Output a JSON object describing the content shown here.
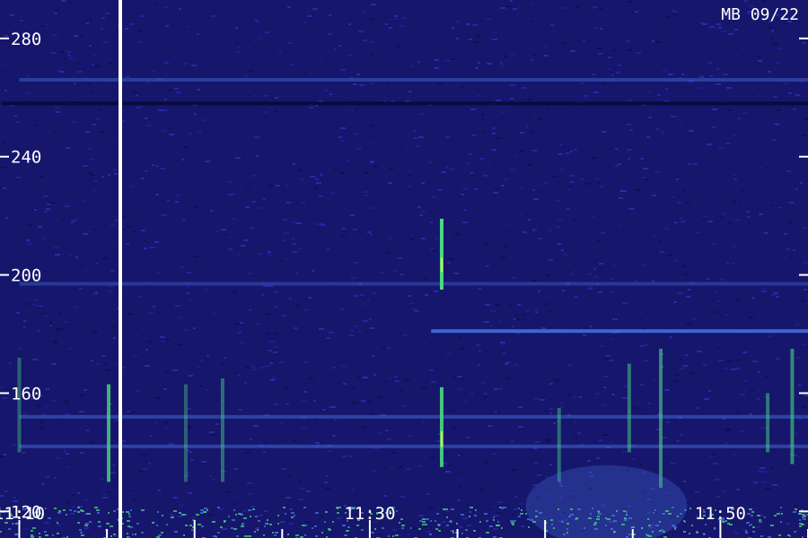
{
  "stamp": "MB 09/22",
  "chart_data": {
    "type": "heatmap",
    "title": "",
    "xlabel": "",
    "ylabel": "",
    "y_ticks": [
      120,
      160,
      200,
      240,
      280
    ],
    "ylim": [
      111,
      293
    ],
    "x_ticks": [
      "11:10",
      "11:30",
      "11:50"
    ],
    "x_tick_values_min": [
      10,
      30,
      50
    ],
    "xlim_min": [
      8.9,
      55
    ],
    "grid": false,
    "colors": {
      "background": "#1a1a7a",
      "noise_low": "#0c0c44",
      "noise_high": "#3a3ad8",
      "band": "#4a7ae8",
      "meteor": "#4ad880",
      "meteor_core": "#e8e83a",
      "axis": "#ffffff"
    },
    "features": [
      {
        "kind": "horizontal-band",
        "y": 181,
        "x_from_min": 33.5,
        "x_to_min": 55,
        "intensity": 0.8
      },
      {
        "kind": "horizontal-band",
        "y": 197,
        "x_from_min": 10,
        "x_to_min": 55,
        "intensity": 0.35
      },
      {
        "kind": "horizontal-band",
        "y": 266,
        "x_from_min": 10,
        "x_to_min": 55,
        "intensity": 0.4
      },
      {
        "kind": "horizontal-band",
        "y": 152,
        "x_from_min": 10,
        "x_to_min": 55,
        "intensity": 0.45
      },
      {
        "kind": "horizontal-band",
        "y": 142,
        "x_from_min": 10,
        "x_to_min": 55,
        "intensity": 0.45
      },
      {
        "kind": "dark-band",
        "y": 258,
        "x_from_min": 9,
        "x_to_min": 55
      },
      {
        "kind": "meteor",
        "x_min": 34.1,
        "y_from": 195,
        "y_to": 219,
        "intensity": 1.0
      },
      {
        "kind": "meteor",
        "x_min": 34.1,
        "y_from": 135,
        "y_to": 162,
        "intensity": 0.9
      },
      {
        "kind": "meteor",
        "x_min": 15.1,
        "y_from": 130,
        "y_to": 163,
        "intensity": 0.8
      },
      {
        "kind": "meteor",
        "x_min": 46.6,
        "y_from": 128,
        "y_to": 175,
        "intensity": 0.6
      },
      {
        "kind": "meteor",
        "x_min": 54.1,
        "y_from": 136,
        "y_to": 175,
        "intensity": 0.6
      },
      {
        "kind": "meteor",
        "x_min": 52.7,
        "y_from": 140,
        "y_to": 160,
        "intensity": 0.5
      },
      {
        "kind": "meteor",
        "x_min": 44.8,
        "y_from": 140,
        "y_to": 170,
        "intensity": 0.5
      },
      {
        "kind": "meteor",
        "x_min": 40.8,
        "y_from": 130,
        "y_to": 155,
        "intensity": 0.45
      },
      {
        "kind": "meteor",
        "x_min": 21.6,
        "y_from": 130,
        "y_to": 165,
        "intensity": 0.45
      },
      {
        "kind": "meteor",
        "x_min": 19.5,
        "y_from": 130,
        "y_to": 163,
        "intensity": 0.4
      },
      {
        "kind": "meteor",
        "x_min": 10.0,
        "y_from": 140,
        "y_to": 172,
        "intensity": 0.4
      },
      {
        "kind": "glow",
        "x_min": 43.5,
        "y": 122,
        "intensity": 0.6
      }
    ]
  }
}
